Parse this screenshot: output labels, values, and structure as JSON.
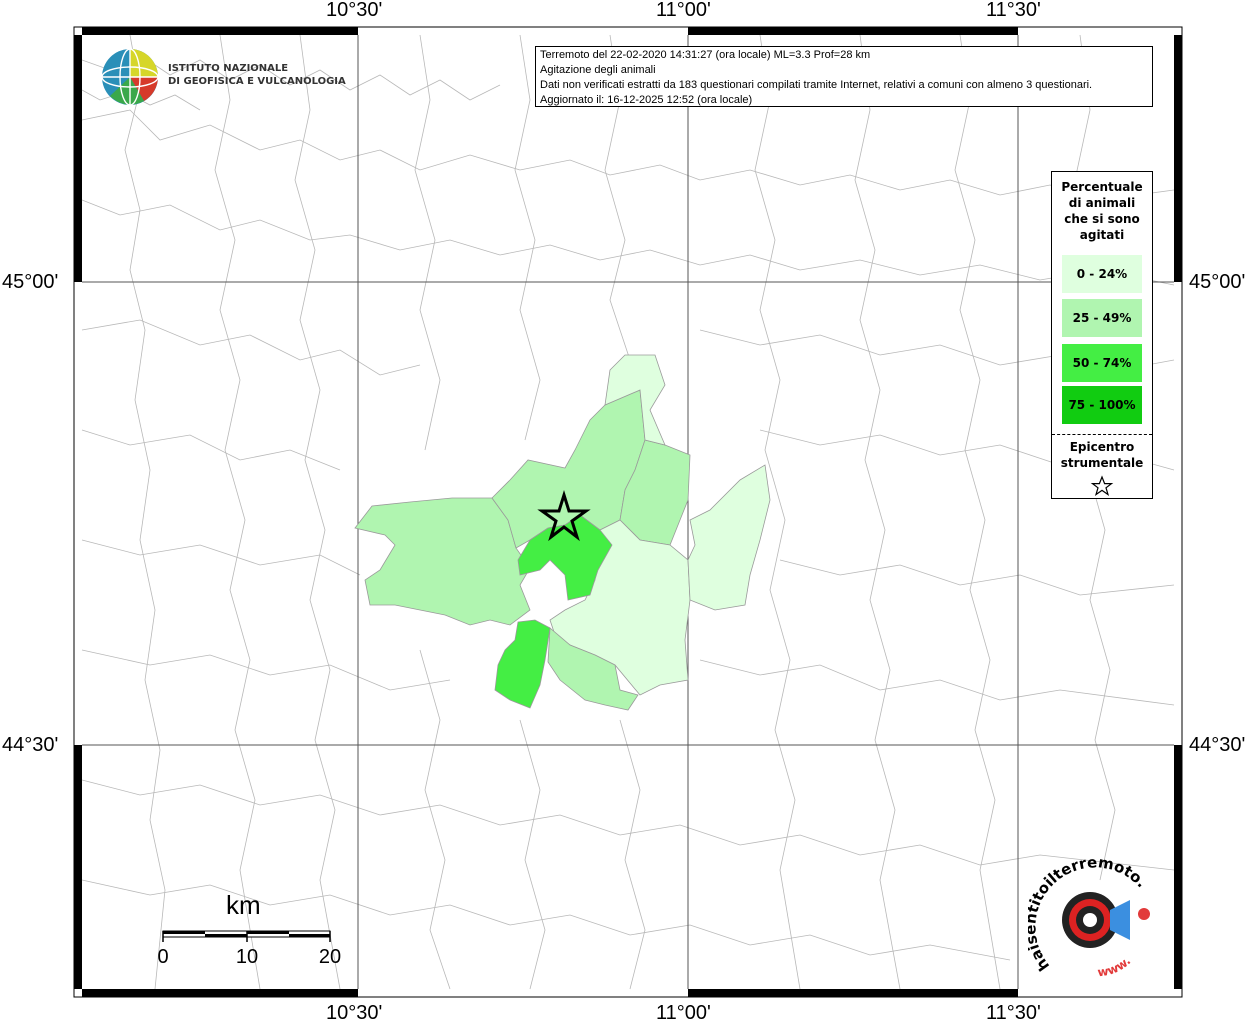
{
  "map": {
    "top_lon_labels": [
      "10°30'",
      "11°00'",
      "11°30'"
    ],
    "bottom_lon_labels": [
      "10°30'",
      "11°00'",
      "11°30'"
    ],
    "left_lat_labels": [
      "45°00'",
      "44°30'"
    ],
    "right_lat_labels": [
      "45°00'",
      "44°30'"
    ]
  },
  "info": {
    "line1": "Terremoto del 22-02-2020 14:31:27 (ora locale) ML=3.3 Prof=28 km",
    "line2": "Agitazione degli animali",
    "line3": "Dati non verificati estratti da 183 questionari compilati tramite Internet, relativi a comuni con almeno 3 questionari.",
    "line4": "Aggiornato il: 16-12-2025 12:52 (ora locale)"
  },
  "logo": {
    "line1": "ISTITUTO NAZIONALE",
    "line2": "DI GEOFISICA E VULCANOLOGIA"
  },
  "legend": {
    "title_lines": [
      "Percentuale",
      "di animali",
      "che si sono",
      "agitati"
    ],
    "classes": [
      {
        "label": "0 - 24%",
        "color": "#dfffdf"
      },
      {
        "label": "25 - 49%",
        "color": "#b0f5b0"
      },
      {
        "label": "50 - 74%",
        "color": "#44ee44"
      },
      {
        "label": "75 - 100%",
        "color": "#11cc11"
      }
    ],
    "epicenter_lines": [
      "Epicentro",
      "strumentale"
    ]
  },
  "scale": {
    "unit": "km",
    "ticks": [
      "0",
      "10",
      "20"
    ]
  },
  "brand": {
    "text": "haisentitoilterremoto.it",
    "www": "www."
  }
}
